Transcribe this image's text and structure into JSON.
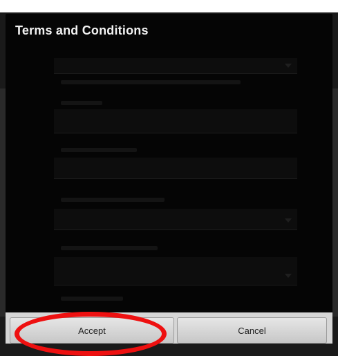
{
  "dialog": {
    "title": "Terms and Conditions"
  },
  "buttons": {
    "accept_label": "Accept",
    "cancel_label": "Cancel"
  },
  "annotation": {
    "highlight_color": "#ee1010",
    "highlight_target": "accept-button"
  }
}
